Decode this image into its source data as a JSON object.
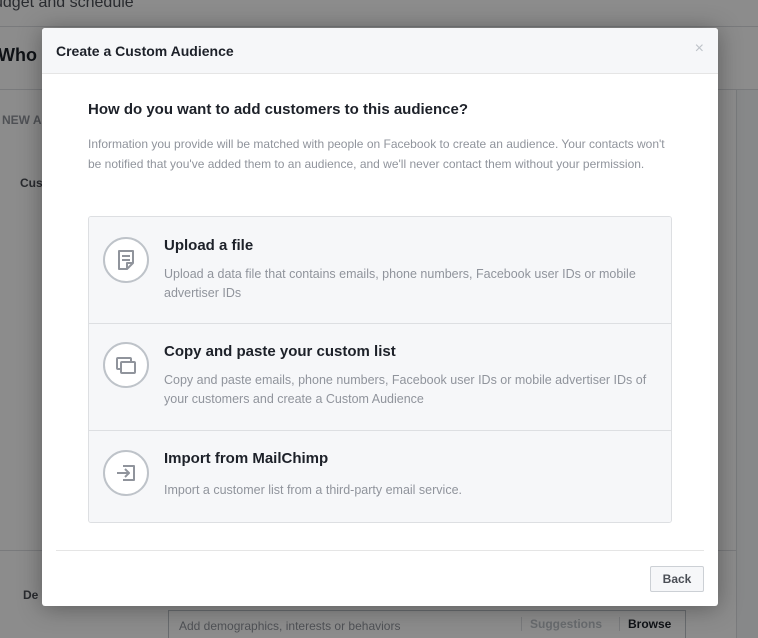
{
  "background": {
    "top_text": "udget and schedule",
    "section_title": "Who c",
    "new_label": "NEW A",
    "cust_label": "Cus",
    "demo_label": "De",
    "demo_input_placeholder": "Add demographics, interests or behaviors",
    "suggestions_label": "Suggestions",
    "browse_label": "Browse"
  },
  "modal": {
    "title": "Create a Custom Audience",
    "close_glyph": "×",
    "question": "How do you want to add customers to this audience?",
    "description": "Information you provide will be matched with people on Facebook to create an audience. Your contacts won't be notified that you've added them to an audience, and we'll never contact them without your permission.",
    "options": [
      {
        "title": "Upload a file",
        "description": "Upload a data file that contains emails, phone numbers, Facebook user IDs or mobile advertiser IDs",
        "icon": "file-upload-icon"
      },
      {
        "title": "Copy and paste your custom list",
        "description": "Copy and paste emails, phone numbers, Facebook user IDs or mobile advertiser IDs of your customers and create a Custom Audience",
        "icon": "copy-paste-icon"
      },
      {
        "title": "Import from MailChimp",
        "description": "Import a customer list from a third-party email service.",
        "icon": "import-icon"
      }
    ],
    "back_label": "Back"
  }
}
